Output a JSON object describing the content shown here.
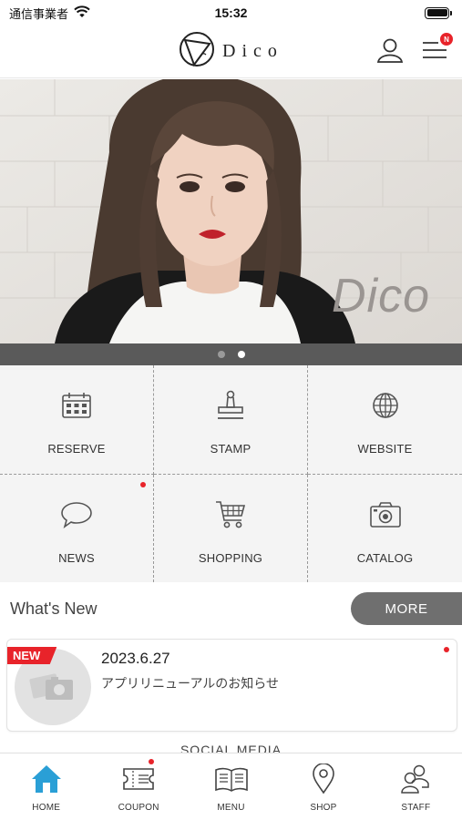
{
  "status_bar": {
    "carrier": "通信事業者",
    "time": "15:32"
  },
  "header": {
    "logo_text": "Dico",
    "menu_badge": "N"
  },
  "hero": {
    "watermark": "Dico",
    "slides_total": 2,
    "active_slide": 2
  },
  "menu_grid": [
    {
      "label": "RESERVE",
      "icon": "calendar-icon"
    },
    {
      "label": "STAMP",
      "icon": "stamp-icon"
    },
    {
      "label": "WEBSITE",
      "icon": "globe-icon"
    },
    {
      "label": "NEWS",
      "icon": "speech-bubble-icon",
      "unread": true
    },
    {
      "label": "SHOPPING",
      "icon": "cart-icon"
    },
    {
      "label": "CATALOG",
      "icon": "camera-icon"
    }
  ],
  "whats_new": {
    "title": "What's New",
    "more_label": "MORE",
    "items": [
      {
        "badge": "NEW",
        "date": "2023.6.27",
        "text": "アプリリニューアルのお知らせ",
        "unread": true
      }
    ]
  },
  "social_label": "SOCIAL MEDIA",
  "tab_bar": [
    {
      "label": "HOME",
      "icon": "home-icon",
      "active": true
    },
    {
      "label": "COUPON",
      "icon": "coupon-icon",
      "unread": true
    },
    {
      "label": "MENU",
      "icon": "book-icon"
    },
    {
      "label": "SHOP",
      "icon": "location-pin-icon"
    },
    {
      "label": "STAFF",
      "icon": "people-icon"
    }
  ],
  "colors": {
    "accent_red": "#e8232a",
    "home_blue": "#2a9fd6",
    "more_gray": "#6f6f6f",
    "grid_bg": "#f4f4f4"
  }
}
